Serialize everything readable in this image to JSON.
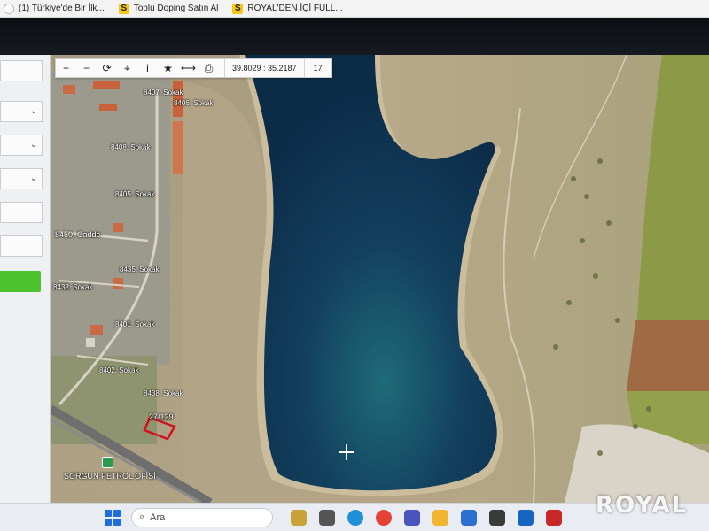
{
  "bookmarks": [
    {
      "label": "(1) Türkiye'de Bir İlk...",
      "icon": "page-icon"
    },
    {
      "label": "Toplu Doping Satın Al",
      "icon": "s-letter-icon",
      "badge": "S"
    },
    {
      "label": "ROYAL'DEN İÇİ FULL...",
      "icon": "s-letter-icon",
      "badge": "S"
    }
  ],
  "toolbar": {
    "buttons": [
      {
        "glyph": "+",
        "icon": "zoom-in-icon"
      },
      {
        "glyph": "−",
        "icon": "zoom-out-icon"
      },
      {
        "glyph": "⟳",
        "icon": "refresh-icon"
      },
      {
        "glyph": "⌖",
        "icon": "locate-icon"
      },
      {
        "glyph": "i",
        "icon": "info-icon"
      },
      {
        "glyph": "★",
        "icon": "star-icon"
      },
      {
        "glyph": "⟷",
        "icon": "measure-icon"
      },
      {
        "glyph": "⎙",
        "icon": "print-icon"
      }
    ],
    "coordinates": "39.8029 : 35.2187",
    "zoom_level": "17"
  },
  "map": {
    "labels": {
      "road_8408": "8408. Sokak",
      "road_8405": "8405. Sokak",
      "road_8450": "8450. Cadde",
      "road_8432": "8432. Sokak",
      "road_8435": "8435. Sokak",
      "road_8402": "8402. Sokak",
      "road_8407": "8407. Sokak",
      "road_8406": "8406. Sokak",
      "road_8401": "8401. Sokak",
      "road_8438": "8438. Sokak",
      "parcel": "27/129",
      "poi": "SORGUN PETROL OFİSİ"
    },
    "colors": {
      "water": "#0f2e4a",
      "parcel_outline": "#d0121e",
      "land": "#b9a98a"
    }
  },
  "left_panel": {
    "accent_color": "#4cc22e"
  },
  "watermark": "ROYAL",
  "taskbar": {
    "search_placeholder": "Ara"
  }
}
